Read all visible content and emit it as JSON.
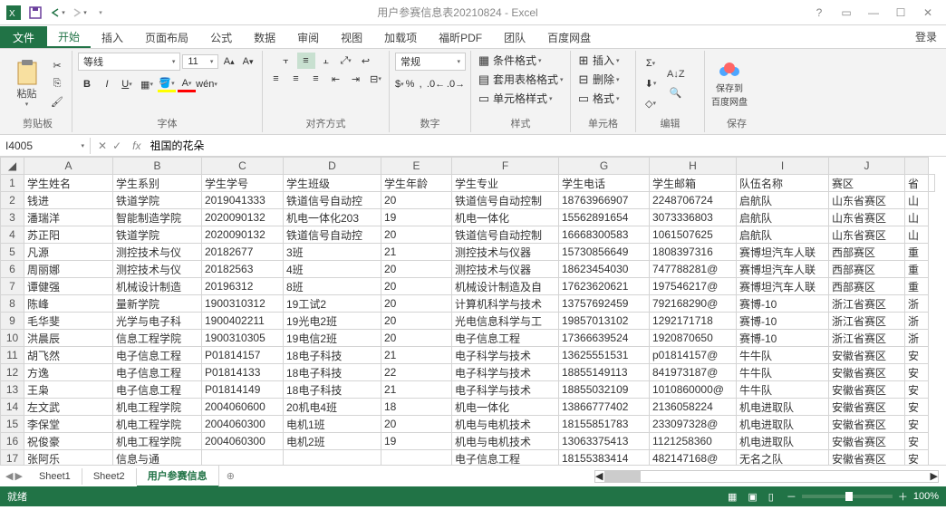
{
  "title": "用户参赛信息表20210824 - Excel",
  "tabs": {
    "file": "文件",
    "home": "开始",
    "insert": "插入",
    "layout": "页面布局",
    "formulas": "公式",
    "data": "数据",
    "review": "审阅",
    "view": "视图",
    "addins": "加载项",
    "foxit": "福昕PDF",
    "team": "团队",
    "baidu": "百度网盘",
    "login": "登录"
  },
  "ribbon": {
    "clipboard": {
      "paste": "粘贴",
      "label": "剪贴板"
    },
    "font": {
      "name": "等线",
      "size": "11",
      "label": "字体"
    },
    "align": {
      "label": "对齐方式"
    },
    "number": {
      "format": "常规",
      "label": "数字"
    },
    "styles": {
      "cond": "条件格式",
      "table": "套用表格格式",
      "cell": "单元格样式",
      "label": "样式"
    },
    "cells": {
      "insert": "插入",
      "delete": "删除",
      "format": "格式",
      "label": "单元格"
    },
    "editing": {
      "label": "编辑"
    },
    "save": {
      "btn": "保存到\n百度网盘",
      "label": "保存"
    }
  },
  "namebox": "I4005",
  "formula": "祖国的花朵",
  "headers": [
    "A",
    "B",
    "C",
    "D",
    "E",
    "F",
    "G",
    "H",
    "I",
    "J",
    ""
  ],
  "row1": [
    "学生姓名",
    "学生系别",
    "学生学号",
    "学生班级",
    "学生年龄",
    "学生专业",
    "学生电话",
    "学生邮箱",
    "队伍名称",
    "赛区",
    "省"
  ],
  "rows": [
    [
      "2",
      "钱进",
      "铁道学院",
      "2019041333",
      "铁道信号自动控",
      "20",
      "铁道信号自动控制",
      "18763966907",
      "2248706724",
      "启航队",
      "山东省赛区",
      "山"
    ],
    [
      "3",
      "潘瑞洋",
      "智能制造学院",
      "2020090132",
      "机电一体化203",
      "19",
      "机电一体化",
      "15562891654",
      "3073336803",
      "启航队",
      "山东省赛区",
      "山"
    ],
    [
      "4",
      "苏正阳",
      "铁道学院",
      "2020090132",
      "铁道信号自动控",
      "20",
      "铁道信号自动控制",
      "16668300583",
      "1061507625",
      "启航队",
      "山东省赛区",
      "山"
    ],
    [
      "5",
      "凡源",
      "测控技术与仪",
      "20182677",
      "3班",
      "21",
      "测控技术与仪器",
      "15730856649",
      "1808397316",
      "赛博坦汽车人联",
      "西部赛区",
      "重"
    ],
    [
      "6",
      "周丽娜",
      "测控技术与仪",
      "20182563",
      "4班",
      "20",
      "测控技术与仪器",
      "18623454030",
      "747788281@",
      "赛博坦汽车人联",
      "西部赛区",
      "重"
    ],
    [
      "7",
      "谭健强",
      "机械设计制造",
      "20196312",
      "8班",
      "20",
      "机械设计制造及自",
      "17623620621",
      "197546217@",
      "赛博坦汽车人联",
      "西部赛区",
      "重"
    ],
    [
      "8",
      "陈峰",
      "量新学院",
      "1900310312",
      "19工试2",
      "20",
      "计算机科学与技术",
      "13757692459",
      "792168290@",
      "赛博-10",
      "浙江省赛区",
      "浙"
    ],
    [
      "9",
      "毛华斐",
      "光学与电子科",
      "1900402211",
      "19光电2班",
      "20",
      "光电信息科学与工",
      "19857013102",
      "1292171718",
      "赛博-10",
      "浙江省赛区",
      "浙"
    ],
    [
      "10",
      "洪晨辰",
      "信息工程学院",
      "1900310305",
      "19电信2班",
      "20",
      "电子信息工程",
      "17366639524",
      "1920870650",
      "赛博-10",
      "浙江省赛区",
      "浙"
    ],
    [
      "11",
      "胡飞然",
      "电子信息工程",
      "P01814157",
      "18电子科技",
      "21",
      "电子科学与技术",
      "13625551531",
      "p01814157@",
      "牛牛队",
      "安徽省赛区",
      "安"
    ],
    [
      "12",
      "方逸",
      "电子信息工程",
      "P01814133",
      "18电子科技",
      "22",
      "电子科学与技术",
      "18855149113",
      "841973187@",
      "牛牛队",
      "安徽省赛区",
      "安"
    ],
    [
      "13",
      "王枭",
      "电子信息工程",
      "P01814149",
      "18电子科技",
      "21",
      "电子科学与技术",
      "18855032109",
      "1010860000@",
      "牛牛队",
      "安徽省赛区",
      "安"
    ],
    [
      "14",
      "左文武",
      "机电工程学院",
      "2004060600",
      "20机电4班",
      "18",
      "机电一体化",
      "13866777402",
      "2136058224",
      "机电进取队",
      "安徽省赛区",
      "安"
    ],
    [
      "15",
      "李保堂",
      "机电工程学院",
      "2004060300",
      "电机1班",
      "20",
      "机电与电机技术",
      "18155851783",
      "233097328@",
      "机电进取队",
      "安徽省赛区",
      "安"
    ],
    [
      "16",
      "祝俊豪",
      "机电工程学院",
      "2004060300",
      "电机2班",
      "19",
      "机电与电机技术",
      "13063375413",
      "1121258360",
      "机电进取队",
      "安徽省赛区",
      "安"
    ],
    [
      "17",
      "张阿乐",
      "信息与通",
      "",
      "",
      "",
      "电子信息工程",
      "18155383414",
      "482147168@",
      "无名之队",
      "安徽省赛区",
      "安"
    ]
  ],
  "sheets": {
    "s1": "Sheet1",
    "s2": "Sheet2",
    "s3": "用户参赛信息"
  },
  "status": {
    "ready": "就绪",
    "zoom": "100%"
  }
}
